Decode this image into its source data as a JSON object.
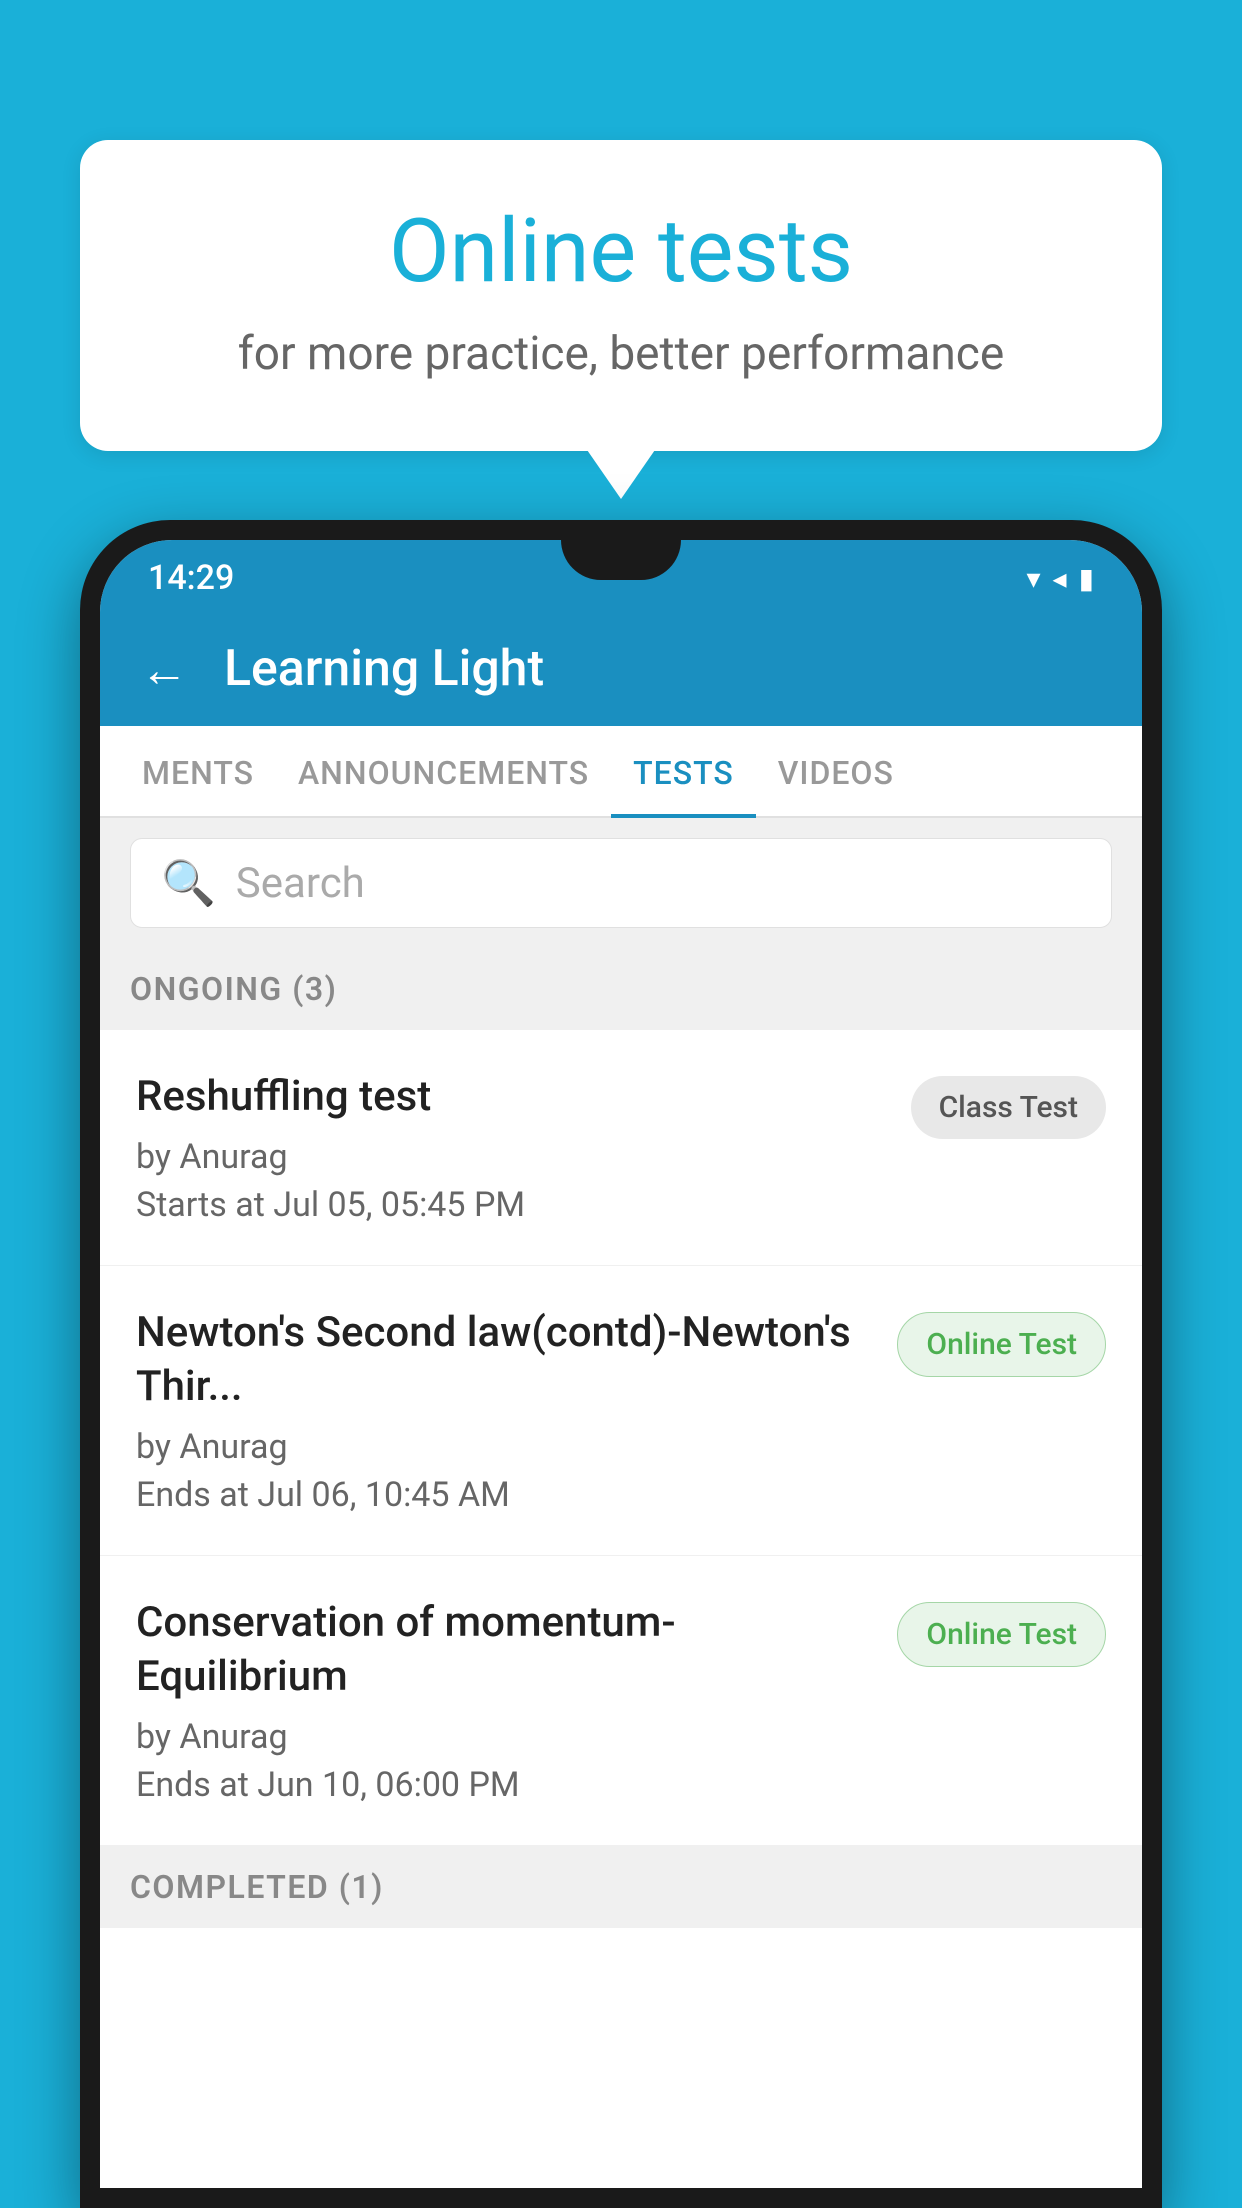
{
  "background": {
    "color": "#1ab0d8"
  },
  "bubble": {
    "title": "Online tests",
    "subtitle": "for more practice, better performance"
  },
  "phone": {
    "status_bar": {
      "time": "14:29",
      "icons": "▾◂▮"
    },
    "app_bar": {
      "title": "Learning Light",
      "back_label": "←"
    },
    "tabs": [
      {
        "label": "MENTS",
        "active": false
      },
      {
        "label": "ANNOUNCEMENTS",
        "active": false
      },
      {
        "label": "TESTS",
        "active": true
      },
      {
        "label": "VIDEOS",
        "active": false
      }
    ],
    "search": {
      "placeholder": "Search"
    },
    "ongoing_section": {
      "label": "ONGOING (3)"
    },
    "tests": [
      {
        "name": "Reshuffling test",
        "author": "by Anurag",
        "date": "Starts at  Jul 05, 05:45 PM",
        "badge": "Class Test",
        "badge_type": "class"
      },
      {
        "name": "Newton's Second law(contd)-Newton's Thir...",
        "author": "by Anurag",
        "date": "Ends at  Jul 06, 10:45 AM",
        "badge": "Online Test",
        "badge_type": "online"
      },
      {
        "name": "Conservation of momentum-Equilibrium",
        "author": "by Anurag",
        "date": "Ends at  Jun 10, 06:00 PM",
        "badge": "Online Test",
        "badge_type": "online"
      }
    ],
    "completed_section": {
      "label": "COMPLETED (1)"
    }
  }
}
